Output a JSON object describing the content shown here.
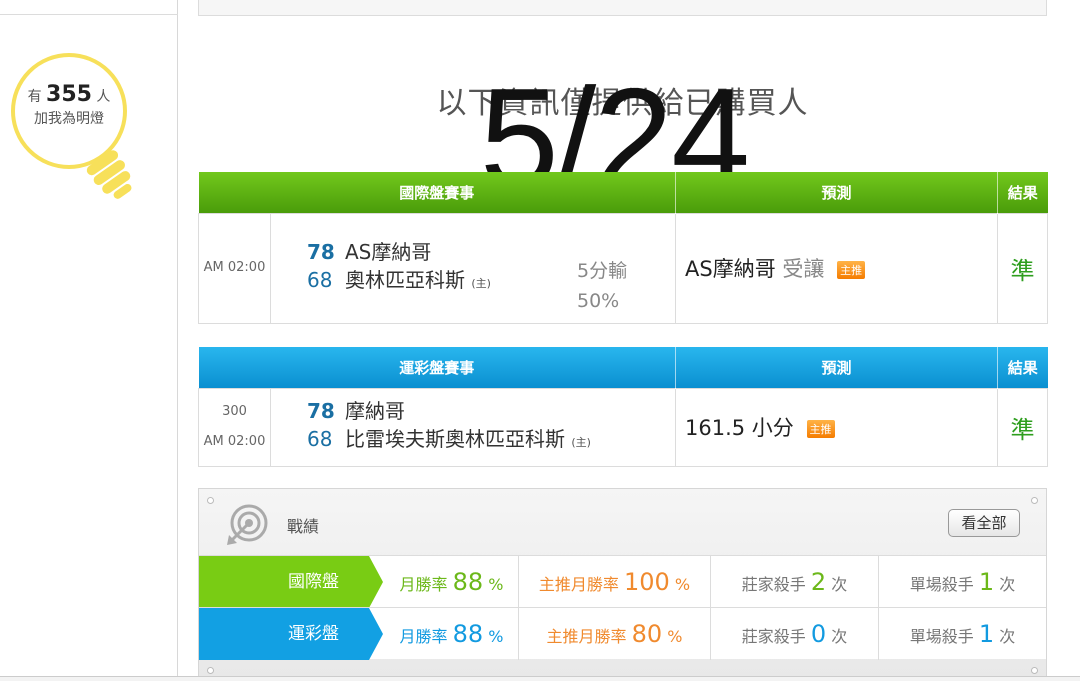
{
  "sidebar": {
    "count_prefix": "有",
    "count": "355",
    "count_suffix": "人",
    "caption": "加我為明燈"
  },
  "notice": "以下資訊僅提供給已購買人",
  "overlay_date": "5/24",
  "intl_table": {
    "headers": [
      "國際盤賽事",
      "預測",
      "結果"
    ],
    "row": {
      "time": "AM 02:00",
      "team1_score": "78",
      "team1_name": "AS摩納哥",
      "team2_score": "68",
      "team2_name": "奧林匹亞科斯",
      "host_mark": "(主)",
      "handicap_line1": "5分輸",
      "handicap_line2": "50%",
      "pred_team": "AS摩納哥",
      "pred_type": "受讓",
      "badge": "主推",
      "result": "準"
    }
  },
  "lottery_table": {
    "headers": [
      "運彩盤賽事",
      "預測",
      "結果"
    ],
    "row": {
      "game_no": "300",
      "time": "AM 02:00",
      "team1_score": "78",
      "team1_name": "摩納哥",
      "team2_score": "68",
      "team2_name": "比雷埃夫斯奧林匹亞科斯",
      "host_mark": "(主)",
      "pred": "161.5 小分",
      "badge": "主推",
      "result": "準"
    }
  },
  "record": {
    "title": "戰績",
    "see_all": "看全部",
    "rows": [
      {
        "label": "國際盤",
        "month_rate_label": "月勝率",
        "month_rate": "88",
        "pct": "%",
        "main_rate_label": "主推月勝率",
        "main_rate": "100",
        "main_pct": "%",
        "killer_label": "莊家殺手",
        "killer": "2",
        "killer_unit": "次",
        "single_label": "單場殺手",
        "single": "1",
        "single_unit": "次"
      },
      {
        "label": "運彩盤",
        "month_rate_label": "月勝率",
        "month_rate": "88",
        "pct": "%",
        "main_rate_label": "主推月勝率",
        "main_rate": "80",
        "main_pct": "%",
        "killer_label": "莊家殺手",
        "killer": "0",
        "killer_unit": "次",
        "single_label": "單場殺手",
        "single": "1",
        "single_unit": "次"
      }
    ]
  },
  "colors": {
    "green": "#79cc14",
    "blue": "#12a0e3",
    "orange": "#f08a2e",
    "result_green": "#2e9e1e",
    "bulb_yellow": "#f7e05a"
  },
  "icons": [
    "lightbulb-icon",
    "target-icon"
  ]
}
